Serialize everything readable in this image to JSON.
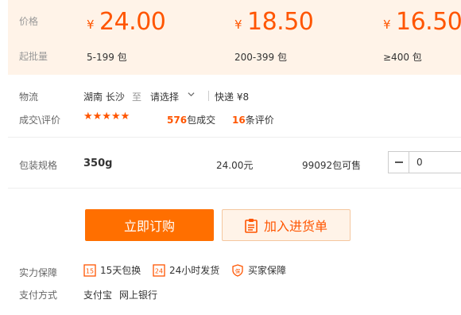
{
  "price_section": {
    "price_label": "价格",
    "batch_label": "起批量",
    "tiers": [
      {
        "currency": "¥",
        "price": "24.00",
        "range": "5-199 包"
      },
      {
        "currency": "¥",
        "price": "18.50",
        "range": "200-399 包"
      },
      {
        "currency": "¥",
        "price": "16.50",
        "range": "≥400 包"
      }
    ]
  },
  "logistics": {
    "label": "物流",
    "origin": "湖南 长沙",
    "to_word": "至",
    "destination": "请选择",
    "shipping": "快递 ¥8"
  },
  "deals": {
    "label": "成交\\评价",
    "stars": "★★★★★",
    "rating": 5,
    "sold_count": "576",
    "sold_suffix": "包成交",
    "review_count": "16",
    "review_suffix": "条评价"
  },
  "spec": {
    "label": "包装规格",
    "name": "350g",
    "price": "24.00元",
    "stock": "99092包可售",
    "quantity": "0"
  },
  "actions": {
    "buy_now": "立即订购",
    "add_to_cart": "加入进货单"
  },
  "guarantees": {
    "label": "实力保障",
    "items": [
      {
        "icon": "15-days-return-icon",
        "text": "15天包换"
      },
      {
        "icon": "24h-shipping-icon",
        "text": "24小时发货"
      },
      {
        "icon": "buyer-protection-icon",
        "text": "买家保障"
      }
    ]
  },
  "payment": {
    "label": "支付方式",
    "methods": [
      "支付宝",
      "网上银行"
    ]
  },
  "colors": {
    "accent": "#ff5500",
    "button": "#ff6f00",
    "price_band_bg": "#fff3e8"
  }
}
